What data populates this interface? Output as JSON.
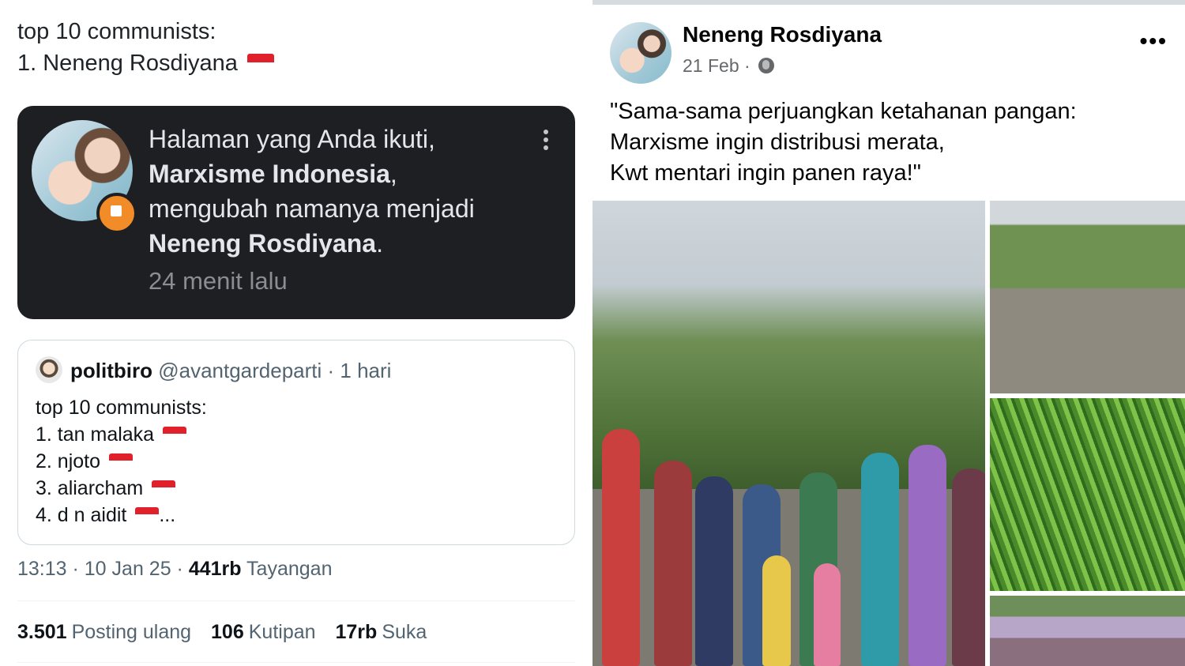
{
  "tweet": {
    "line1": "top 10 communists:",
    "line2": "1. Neneng Rosdiyana",
    "notification": {
      "line1": "Halaman yang Anda ikuti,",
      "page_old": "Marxisme Indonesia",
      "line2_suffix": ",",
      "line3": "mengubah namanya menjadi",
      "page_new": "Neneng Rosdiyana",
      "line4_suffix": ".",
      "time": "24 menit lalu"
    },
    "quoted": {
      "name": "politbiro",
      "handle": "@avantgardeparti",
      "sep": " · ",
      "age": "1 hari",
      "lines": [
        "top 10 communists:",
        "1. tan malaka",
        "2. njoto",
        "3. aliarcham",
        "4. d n aidit"
      ],
      "ellipsis": "..."
    },
    "meta": {
      "time": "13:13",
      "dot": " · ",
      "date": "10 Jan 25",
      "views": "441rb",
      "views_label": "Tayangan"
    },
    "stats": [
      {
        "value": "3.501",
        "label": "Posting ulang"
      },
      {
        "value": "106",
        "label": "Kutipan"
      },
      {
        "value": "17rb",
        "label": "Suka"
      }
    ]
  },
  "facebook": {
    "name": "Neneng Rosdiyana",
    "date": "21 Feb",
    "date_sep": " · ",
    "more": "•••",
    "post_lines": [
      "\"Sama-sama perjuangkan ketahanan pangan:",
      "Marxisme ingin distribusi merata,",
      "Kwt mentari ingin panen raya!\""
    ]
  },
  "colors": {
    "dark_card": "#1e1f22",
    "flag_red": "#e0202b",
    "badge_orange": "#f28c28",
    "muted": "#536471"
  }
}
